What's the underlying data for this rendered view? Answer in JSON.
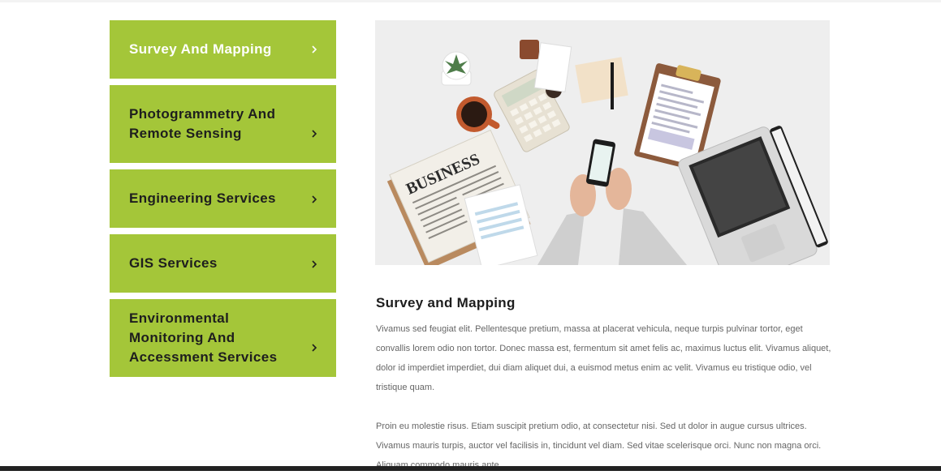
{
  "sidebar": {
    "items": [
      {
        "label": "Survey And Mapping",
        "active": true
      },
      {
        "label": "Photogrammetry And Remote Sensing",
        "active": false
      },
      {
        "label": "Engineering Services",
        "active": false
      },
      {
        "label": "GIS Services",
        "active": false
      },
      {
        "label": "Environmental Monitoring And Accessment Services",
        "active": false
      }
    ]
  },
  "hero": {
    "newspaper_headline": "BUSINESS"
  },
  "content": {
    "title": "Survey and Mapping",
    "paragraphs": [
      "Vivamus sed feugiat elit. Pellentesque pretium, massa at placerat vehicula, neque turpis pulvinar tortor, eget convallis lorem odio non tortor. Donec massa est, fermentum sit amet felis ac, maximus luctus elit. Vivamus aliquet, dolor id imperdiet imperdiet, dui diam aliquet dui, a euismod metus enim ac velit. Vivamus eu tristique odio, vel tristique quam.",
      "Proin eu molestie risus. Etiam suscipit pretium odio, at consectetur nisi. Sed ut dolor in augue cursus ultrices. Vivamus mauris turpis, auctor vel facilisis in, tincidunt vel diam. Sed vitae scelerisque orci. Nunc non magna orci. Aliquam commodo mauris ante."
    ]
  },
  "colors": {
    "accent": "#a4c639",
    "footer": "#222222",
    "body_text": "#666666",
    "heading": "#1d1d1d"
  }
}
